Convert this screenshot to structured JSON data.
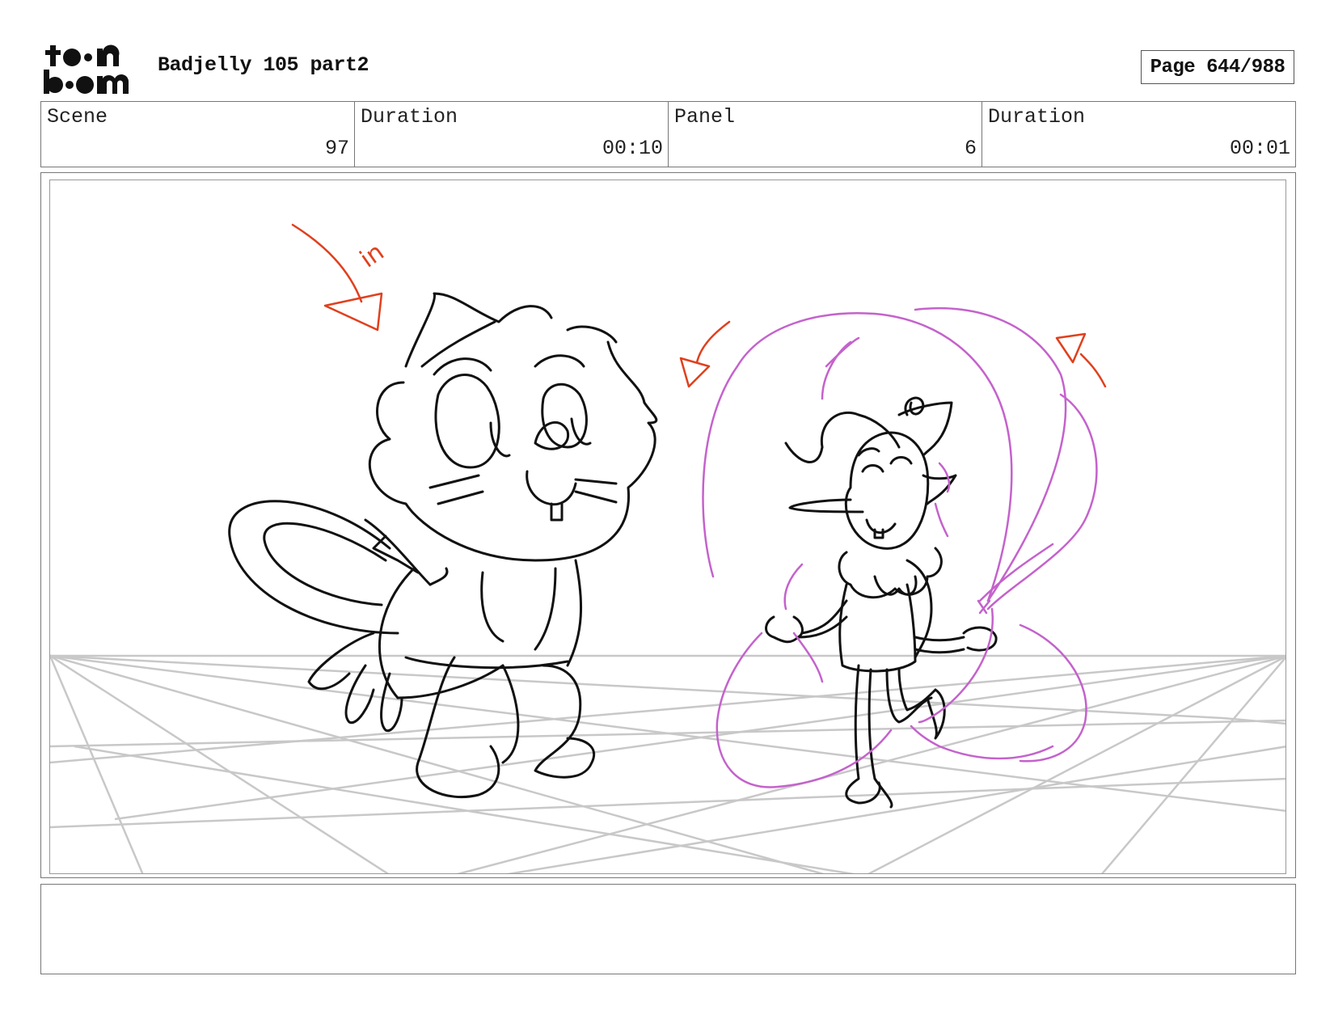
{
  "header": {
    "logo_alt": "toon boom",
    "title": "Badjelly 105 part2",
    "page_label": "Page 644/988"
  },
  "info": {
    "scene_label": "Scene",
    "scene_value": "97",
    "scene_duration_label": "Duration",
    "scene_duration_value": "00:10",
    "panel_label": "Panel",
    "panel_value": "6",
    "panel_duration_label": "Duration",
    "panel_duration_value": "00:01"
  },
  "panel": {
    "annotation_text": "in",
    "colors": {
      "lineart": "#111111",
      "annotation": "#e0401e",
      "effect": "#c462cc",
      "perspective_grid": "#c8c8c8"
    },
    "icons": [
      "curved-arrow-in-icon",
      "curved-arrow-left-icon",
      "curved-arrow-right-icon"
    ]
  },
  "notes": {
    "text": ""
  }
}
